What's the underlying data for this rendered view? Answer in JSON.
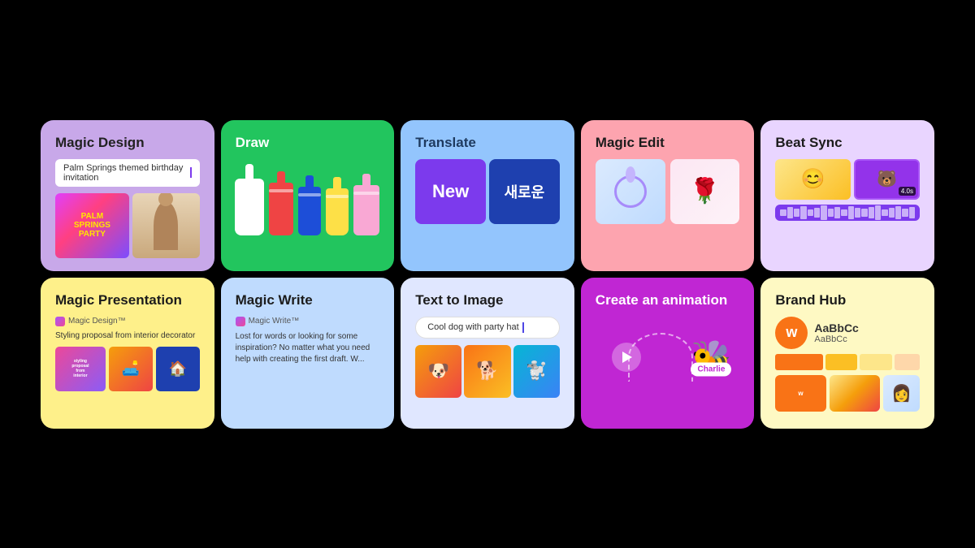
{
  "cards": {
    "magic_design": {
      "title": "Magic Design",
      "input_placeholder": "Palm Springs themed birthday invitation",
      "input_value": "Palm Springs themed birthday invitation"
    },
    "draw": {
      "title": "Draw"
    },
    "translate": {
      "title": "Translate",
      "panel1_text": "New",
      "panel2_text": "새로운"
    },
    "magic_edit": {
      "title": "Magic Edit"
    },
    "beat_sync": {
      "title": "Beat Sync",
      "time_badge": "4.0s"
    },
    "magic_presentation": {
      "title": "Magic Presentation",
      "prompt_label": "Magic Design™",
      "subtitle": "Styling proposal from interior decorator"
    },
    "magic_write": {
      "title": "Magic Write",
      "prompt_label": "Magic Write™",
      "body_text": "Lost for words or looking for some inspiration? No matter what you need help with creating the first draft. W..."
    },
    "text_to_image": {
      "title": "Text to Image",
      "input_value": "Cool dog with party hat"
    },
    "create_animation": {
      "title": "Create an animation",
      "charlie_label": "Charlie"
    },
    "brand_hub": {
      "title": "Brand Hub",
      "logo_letter": "w",
      "font_name": "AaBbCc",
      "font_name2": "AaBbCc"
    }
  }
}
